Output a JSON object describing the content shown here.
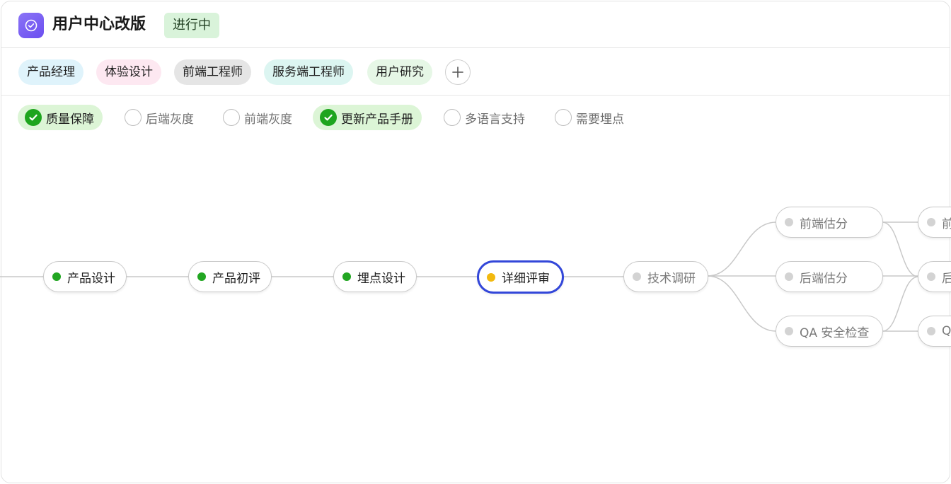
{
  "project": {
    "title": "用户中心改版",
    "status": "进行中",
    "icon": "check-circle-icon",
    "accent": "#7059f3"
  },
  "roles": [
    {
      "label": "产品经理",
      "color": "#dff3fb"
    },
    {
      "label": "体验设计",
      "color": "#fde8f1"
    },
    {
      "label": "前端工程师",
      "color": "#e5e5e5"
    },
    {
      "label": "服务端工程师",
      "color": "#dcf5f1"
    },
    {
      "label": "用户研究",
      "color": "#e6f7e6"
    }
  ],
  "add_role_icon": "plus-icon",
  "checklist": [
    {
      "label": "质量保障",
      "checked": true
    },
    {
      "label": "后端灰度",
      "checked": false
    },
    {
      "label": "前端灰度",
      "checked": false
    },
    {
      "label": "更新产品手册",
      "checked": true
    },
    {
      "label": "多语言支持",
      "checked": false
    },
    {
      "label": "需要埋点",
      "checked": false
    }
  ],
  "workflow": {
    "nodes": [
      {
        "label": "产品设计",
        "state": "done"
      },
      {
        "label": "产品初评",
        "state": "done"
      },
      {
        "label": "埋点设计",
        "state": "done"
      },
      {
        "label": "详细评审",
        "state": "current"
      },
      {
        "label": "技术调研",
        "state": "todo"
      },
      {
        "label": "前端估分",
        "state": "todo"
      },
      {
        "label": "后端估分",
        "state": "todo"
      },
      {
        "label": "QA 安全检查",
        "state": "todo"
      },
      {
        "label": "前",
        "state": "todo"
      },
      {
        "label": "后",
        "state": "todo"
      },
      {
        "label": "Q",
        "state": "todo"
      }
    ],
    "colors": {
      "done": "#22a622",
      "current": "#f2b90f",
      "todo": "#d3d3d3",
      "current_border": "#3347d9"
    }
  }
}
